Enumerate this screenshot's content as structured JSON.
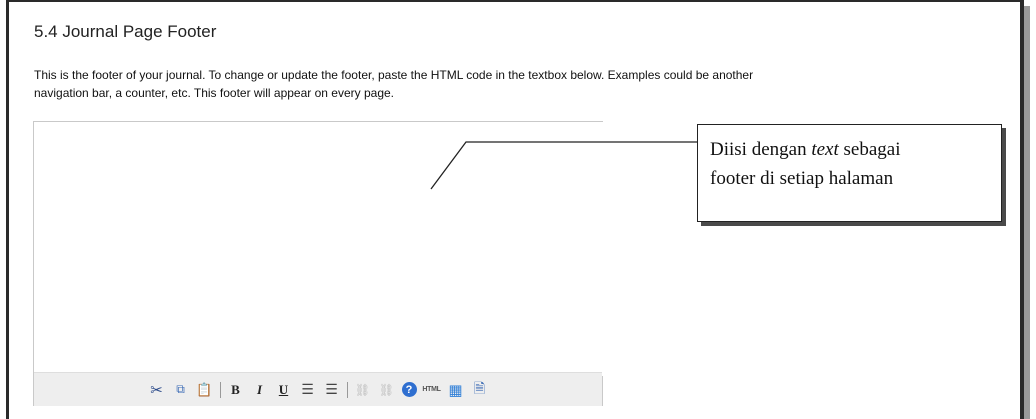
{
  "section": {
    "title": "5.4 Journal Page Footer",
    "description_line1": "This is the footer of your journal. To change or update the footer, paste the HTML code in the textbox below. Examples could be another",
    "description_line2": "navigation bar, a counter, etc. This footer will appear on every page."
  },
  "editor": {
    "value": "",
    "toolbar": {
      "buttons": [
        {
          "name": "cut-icon",
          "glyph": "✂"
        },
        {
          "name": "copy-icon",
          "glyph": "⧉"
        },
        {
          "name": "paste-icon",
          "glyph": "📋"
        },
        {
          "name": "bold-icon",
          "glyph": "B"
        },
        {
          "name": "italic-icon",
          "glyph": "I"
        },
        {
          "name": "underline-icon",
          "glyph": "U"
        },
        {
          "name": "bullet-list-icon",
          "glyph": "☰"
        },
        {
          "name": "numbered-list-icon",
          "glyph": "☰"
        },
        {
          "name": "link-icon",
          "glyph": "⛓"
        },
        {
          "name": "unlink-icon",
          "glyph": "⛓"
        },
        {
          "name": "help-icon",
          "glyph": "?"
        },
        {
          "name": "html-icon",
          "glyph": "HTML"
        },
        {
          "name": "image-icon",
          "glyph": "▦"
        },
        {
          "name": "file-icon",
          "glyph": "🗎"
        }
      ]
    }
  },
  "callout": {
    "line1_before": "Diisi dengan ",
    "line1_emphasis": "text",
    "line1_after": " sebagai",
    "line2": "footer di setiap halaman"
  },
  "colors": {
    "frame": "#2a2a2a",
    "toolbar_bg": "#eeeeee",
    "editor_border": "#c9c9c9",
    "callout_shadow": "#4a4a4a"
  }
}
